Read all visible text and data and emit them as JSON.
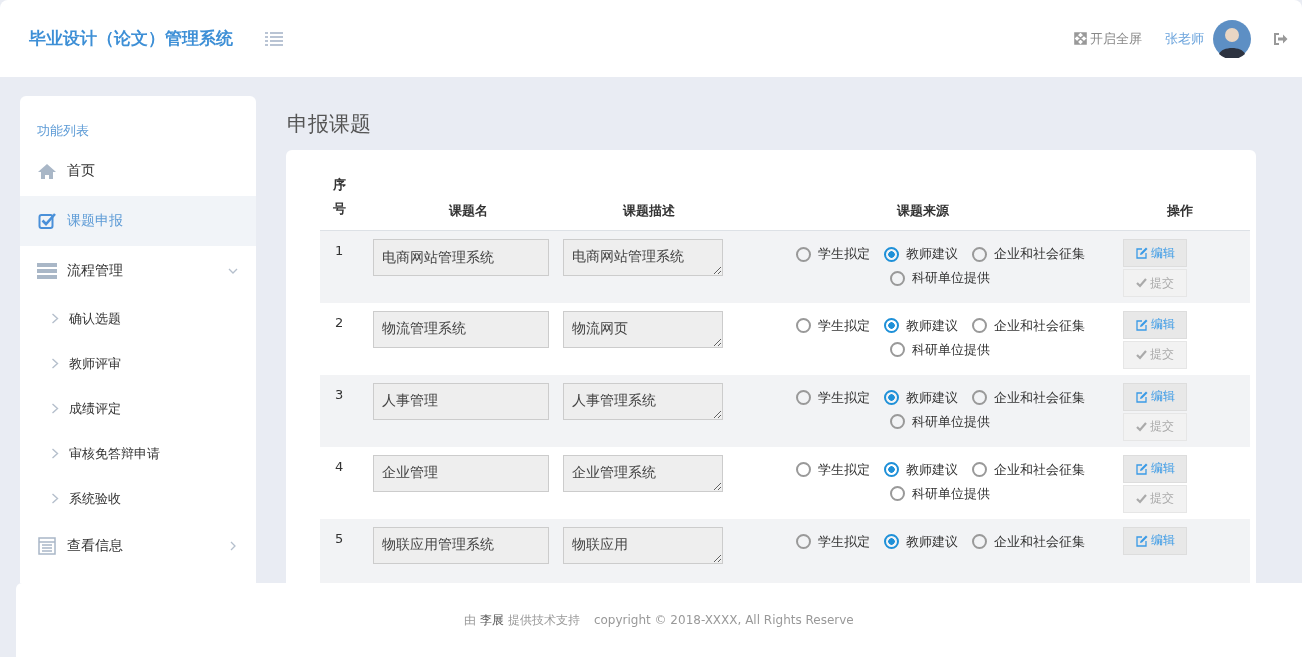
{
  "header": {
    "title": "毕业设计（论文）管理系统",
    "fullscreen": "开启全屏",
    "user": "张老师"
  },
  "sidebar": {
    "heading": "功能列表",
    "items": [
      {
        "label": "首页",
        "selected": false
      },
      {
        "label": "课题申报",
        "selected": true
      },
      {
        "label": "流程管理",
        "selected": false,
        "expanded": true,
        "children": [
          {
            "label": "确认选题"
          },
          {
            "label": "教师评审"
          },
          {
            "label": "成绩评定"
          },
          {
            "label": "审核免答辩申请"
          },
          {
            "label": "系统验收"
          }
        ]
      },
      {
        "label": "查看信息",
        "selected": false,
        "expanded": false
      }
    ]
  },
  "page": {
    "title": "申报课题"
  },
  "table": {
    "columns": [
      "序号",
      "课题名",
      "课题描述",
      "课题来源",
      "操作"
    ],
    "rows": [
      {
        "index": "1",
        "name": "电商网站管理系统",
        "description": "电商网站管理系统",
        "sources": [
          {
            "label": "学生拟定",
            "selected": false
          },
          {
            "label": "教师建议",
            "selected": true
          },
          {
            "label": "企业和社会征集",
            "selected": false
          },
          {
            "label": "科研单位提供",
            "selected": false
          }
        ],
        "actions": [
          {
            "kind": "edit",
            "label": "编辑",
            "disabled": false
          },
          {
            "kind": "submit",
            "label": "提交",
            "disabled": true
          }
        ]
      },
      {
        "index": "2",
        "name": "物流管理系统",
        "description": "物流网页",
        "sources": [
          {
            "label": "学生拟定",
            "selected": false
          },
          {
            "label": "教师建议",
            "selected": true
          },
          {
            "label": "企业和社会征集",
            "selected": false
          },
          {
            "label": "科研单位提供",
            "selected": false
          }
        ],
        "actions": [
          {
            "kind": "edit",
            "label": "编辑",
            "disabled": false
          },
          {
            "kind": "submit",
            "label": "提交",
            "disabled": true
          }
        ]
      },
      {
        "index": "3",
        "name": "人事管理",
        "description": "人事管理系统",
        "sources": [
          {
            "label": "学生拟定",
            "selected": false
          },
          {
            "label": "教师建议",
            "selected": true
          },
          {
            "label": "企业和社会征集",
            "selected": false
          },
          {
            "label": "科研单位提供",
            "selected": false
          }
        ],
        "actions": [
          {
            "kind": "edit",
            "label": "编辑",
            "disabled": false
          },
          {
            "kind": "submit",
            "label": "提交",
            "disabled": true
          }
        ]
      },
      {
        "index": "4",
        "name": "企业管理",
        "description": "企业管理系统",
        "sources": [
          {
            "label": "学生拟定",
            "selected": false
          },
          {
            "label": "教师建议",
            "selected": true
          },
          {
            "label": "企业和社会征集",
            "selected": false
          },
          {
            "label": "科研单位提供",
            "selected": false
          }
        ],
        "actions": [
          {
            "kind": "edit",
            "label": "编辑",
            "disabled": false
          },
          {
            "kind": "submit",
            "label": "提交",
            "disabled": true
          }
        ]
      },
      {
        "index": "5",
        "name": "物联应用管理系统",
        "description": "物联应用",
        "sources": [
          {
            "label": "学生拟定",
            "selected": false
          },
          {
            "label": "教师建议",
            "selected": true
          },
          {
            "label": "企业和社会征集",
            "selected": false
          }
        ],
        "actions": [
          {
            "kind": "edit",
            "label": "编辑",
            "disabled": false
          }
        ]
      }
    ]
  },
  "footer": {
    "credit": "由 **李展** 提供技术支持",
    "copyright": "copyright © 2018-XXXX, All Rights Reserve"
  }
}
